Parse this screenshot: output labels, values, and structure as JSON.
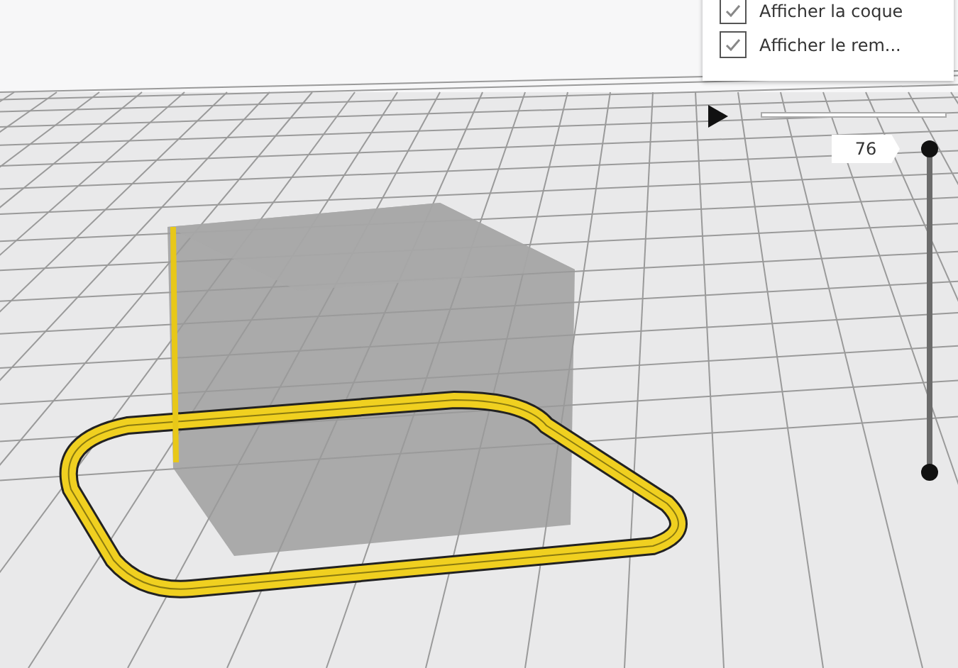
{
  "view_options": [
    {
      "label": "Afficher la coque",
      "checked": true
    },
    {
      "label": "Afficher le rem...",
      "checked": true
    }
  ],
  "layer_slider": {
    "value": "76",
    "level": 1
  }
}
